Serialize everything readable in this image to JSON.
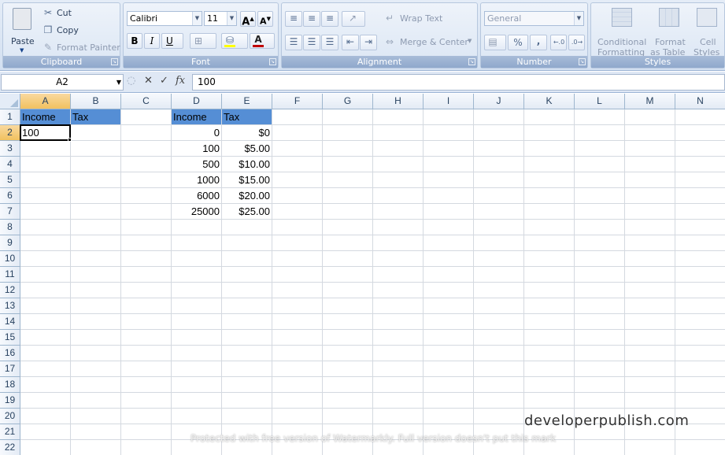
{
  "ribbon": {
    "clipboard": {
      "label": "Clipboard",
      "paste": "Paste",
      "cut": "Cut",
      "copy": "Copy",
      "format_painter": "Format Painter"
    },
    "font": {
      "label": "Font",
      "font_name": "Calibri",
      "font_size": "11",
      "bold": "B",
      "italic": "I",
      "underline": "U"
    },
    "alignment": {
      "label": "Alignment",
      "wrap_text": "Wrap Text",
      "merge_center": "Merge & Center"
    },
    "number": {
      "label": "Number",
      "format": "General",
      "percent": "%",
      "comma": ","
    },
    "styles": {
      "label": "Styles",
      "conditional": "Conditional",
      "formatting": "Formatting",
      "format": "Format",
      "as_table": "as Table",
      "cell": "Cell",
      "cell_styles": "Styles"
    }
  },
  "formula_bar": {
    "name_box": "A2",
    "formula": "100",
    "fx": "fx"
  },
  "columns": [
    "A",
    "B",
    "C",
    "D",
    "E",
    "F",
    "G",
    "H",
    "I",
    "J",
    "K",
    "L",
    "M",
    "N"
  ],
  "rows": [
    "1",
    "2",
    "3",
    "4",
    "5",
    "6",
    "7",
    "8",
    "9",
    "10",
    "11",
    "12",
    "13",
    "14",
    "15",
    "16",
    "17",
    "18",
    "19",
    "20",
    "21",
    "22"
  ],
  "cells": {
    "A1": "Income",
    "B1": "Tax",
    "D1": "Income",
    "E1": "Tax",
    "A2": "100",
    "D2": "0",
    "E2": "$0",
    "D3": "100",
    "E3": "$5.00",
    "D4": "500",
    "E4": "$10.00",
    "D5": "1000",
    "E5": "$15.00",
    "D6": "6000",
    "E6": "$20.00",
    "D7": "25000",
    "E7": "$25.00"
  },
  "watermark": "developerpublish.com",
  "protected_notice": "Protected with free version of Watermarkly. Full version doesn't put this mark"
}
